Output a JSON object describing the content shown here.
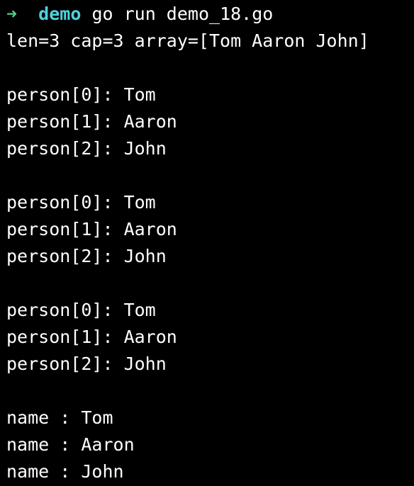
{
  "prompt": {
    "arrow": "➜",
    "dir": "demo",
    "command": "go run demo_18.go"
  },
  "output": {
    "summary": "len=3 cap=3 array=[Tom Aaron John]",
    "block1": [
      "person[0]: Tom",
      "person[1]: Aaron",
      "person[2]: John"
    ],
    "block2": [
      "person[0]: Tom",
      "person[1]: Aaron",
      "person[2]: John"
    ],
    "block3": [
      "person[0]: Tom",
      "person[1]: Aaron",
      "person[2]: John"
    ],
    "names": [
      "name : Tom",
      "name : Aaron",
      "name : John"
    ]
  },
  "colors": {
    "background": "#000000",
    "text": "#ffffff",
    "prompt_arrow": "#4fd18a",
    "prompt_dir": "#4dd3dd"
  }
}
